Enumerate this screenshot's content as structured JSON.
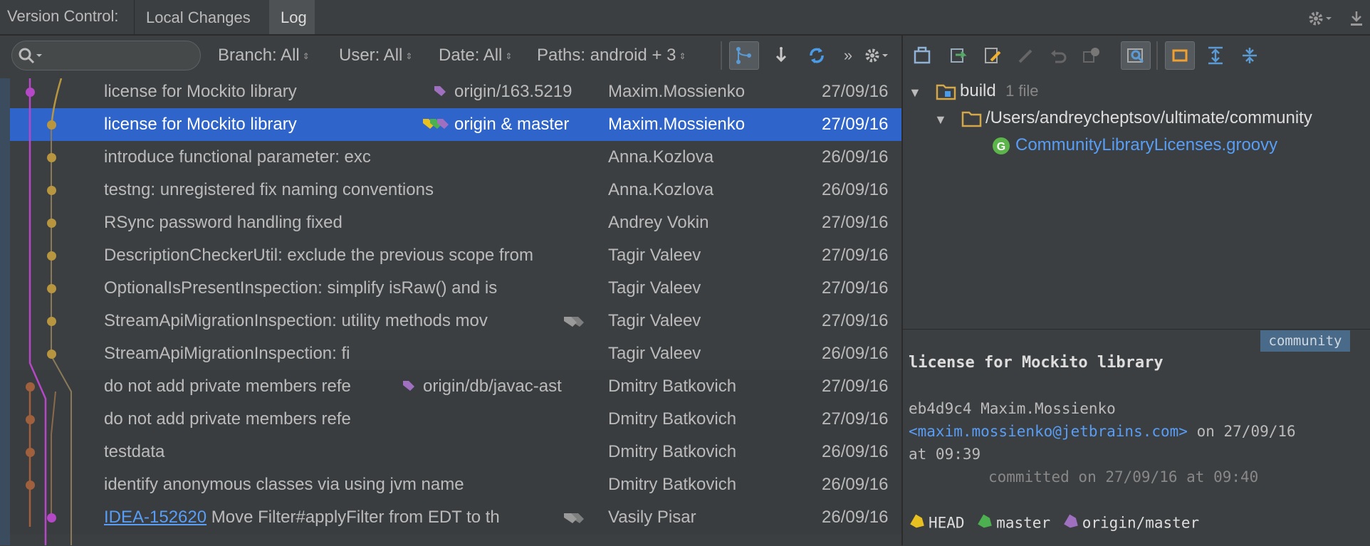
{
  "header": {
    "title": "Version Control:",
    "tabs": [
      {
        "label": "Local Changes"
      },
      {
        "label": "Log"
      }
    ]
  },
  "filters": {
    "branch": "Branch: All",
    "user": "User: All",
    "date": "Date: All",
    "paths": "Paths: android + 3"
  },
  "commits": [
    {
      "message": "license for Mockito library",
      "refs": "origin/163.5219",
      "author": "Maxim.Mossienko",
      "date": "27/09/16"
    },
    {
      "message": "license for Mockito library",
      "refs": "origin & master",
      "author": "Maxim.Mossienko",
      "date": "27/09/16"
    },
    {
      "message": "introduce functional parameter: exc",
      "refs": "",
      "author": "Anna.Kozlova",
      "date": "26/09/16"
    },
    {
      "message": "testng: unregistered fix naming conventions",
      "refs": "",
      "author": "Anna.Kozlova",
      "date": "26/09/16"
    },
    {
      "message": "RSync password handling fixed",
      "refs": "",
      "author": "Andrey Vokin",
      "date": "27/09/16"
    },
    {
      "message": "DescriptionCheckerUtil: exclude the previous scope from",
      "refs": "",
      "author": "Tagir Valeev",
      "date": "27/09/16"
    },
    {
      "message": "OptionalIsPresentInspection: simplify isRaw() and is",
      "refs": "",
      "author": "Tagir Valeev",
      "date": "27/09/16"
    },
    {
      "message": "StreamApiMigrationInspection: utility methods mov",
      "refs": "",
      "author": "Tagir Valeev",
      "date": "27/09/16"
    },
    {
      "message": "StreamApiMigrationInspection: fi",
      "refs": "",
      "author": "Tagir Valeev",
      "date": "26/09/16"
    },
    {
      "message": "do not add private members refe",
      "refs": "origin/db/javac-ast",
      "author": "Dmitry Batkovich",
      "date": "27/09/16"
    },
    {
      "message": "do not add private members refe",
      "refs": "",
      "author": "Dmitry Batkovich",
      "date": "27/09/16"
    },
    {
      "message": "testdata",
      "refs": "",
      "author": "Dmitry Batkovich",
      "date": "26/09/16"
    },
    {
      "message": "identify anonymous classes via using jvm name",
      "refs": "",
      "author": "Dmitry Batkovich",
      "date": "26/09/16"
    },
    {
      "message": "Move Filter#applyFilter from EDT to th",
      "issue": "IDEA-152620",
      "refs": "",
      "author": "Vasily Pisar",
      "date": "26/09/16"
    }
  ],
  "changes": {
    "root_label": "build",
    "root_count": "1 file",
    "folder": "/Users/andreycheptsov/ultimate/community",
    "file": "CommunityLibraryLicenses.groovy"
  },
  "details": {
    "repo_badge": "community",
    "subject": "license for Mockito library",
    "hash_author": "eb4d9c4 Maxim.Mossienko",
    "email": "<maxim.mossienko@jetbrains.com>",
    "date_suffix": " on 27/09/16",
    "time": "at 09:39",
    "committed": "committed on 27/09/16 at 09:40",
    "refs": [
      "HEAD",
      "master",
      "origin/master"
    ]
  },
  "colors": {
    "selected_row": "#2f65ca",
    "graph_purple": "#b548c6",
    "graph_gold": "#b8963f",
    "graph_brown": "#a0603e",
    "link": "#589df6"
  }
}
